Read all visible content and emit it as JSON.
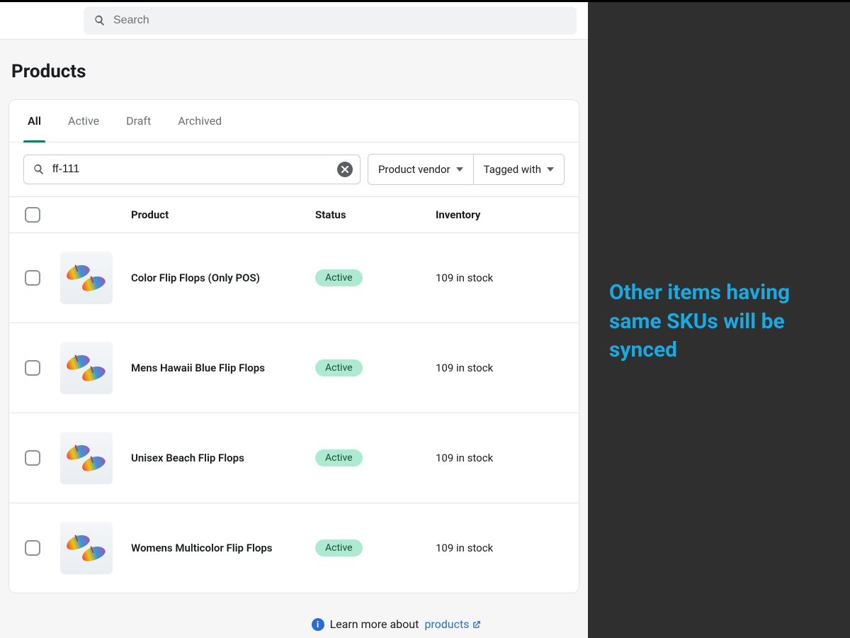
{
  "topbar": {
    "search_placeholder": "Search"
  },
  "page": {
    "title": "Products"
  },
  "tabs": [
    {
      "label": "All",
      "active": true
    },
    {
      "label": "Active",
      "active": false
    },
    {
      "label": "Draft",
      "active": false
    },
    {
      "label": "Archived",
      "active": false
    }
  ],
  "filter": {
    "query": "ff-111",
    "vendor_label": "Product vendor",
    "tagged_label": "Tagged with"
  },
  "columns": {
    "product": "Product",
    "status": "Status",
    "inventory": "Inventory"
  },
  "rows": [
    {
      "name": "Color Flip Flops (Only POS)",
      "status": "Active",
      "inventory": "109 in stock"
    },
    {
      "name": "Mens Hawaii Blue Flip Flops",
      "status": "Active",
      "inventory": "109 in stock"
    },
    {
      "name": "Unisex Beach Flip Flops",
      "status": "Active",
      "inventory": "109 in stock"
    },
    {
      "name": "Womens Multicolor Flip Flops",
      "status": "Active",
      "inventory": "109 in stock"
    }
  ],
  "learn_more": {
    "prefix": "Learn more about",
    "link_text": "products"
  },
  "annotation": {
    "text": "Other items having same SKUs will be synced",
    "color": "#1aa9e0"
  }
}
